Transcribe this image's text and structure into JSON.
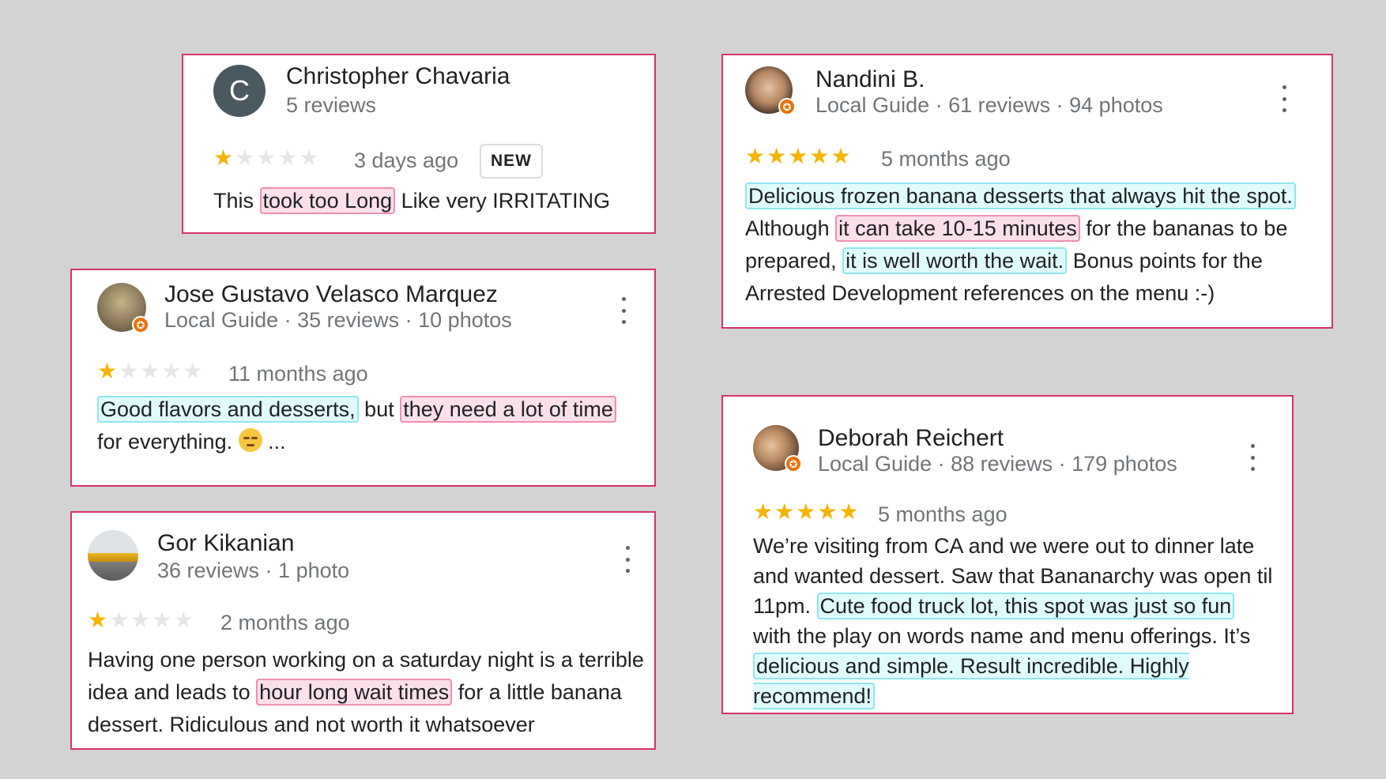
{
  "colors": {
    "background": "#d3d3d3",
    "card_border": "#d6336c",
    "star_filled": "#f5b400",
    "star_empty": "#e6e6e6",
    "positive_highlight": "#e0fbfc",
    "negative_highlight": "#fbe0ea",
    "local_guide_badge": "#e8710a"
  },
  "reviews": [
    {
      "name": "Christopher Chavaria",
      "avatar_letter": "C",
      "meta": "5 reviews",
      "rating": 1,
      "max_rating": 5,
      "time": "3 days ago",
      "badge": "NEW",
      "text": {
        "pre": "This ",
        "neg1": "took too Long",
        "post": " Like very IRRITATING"
      }
    },
    {
      "name": "Jose Gustavo Velasco Marquez",
      "meta": "Local Guide · 35 reviews · 10 photos",
      "rating": 1,
      "max_rating": 5,
      "time": "11 months ago",
      "text": {
        "pos1": "Good flavors and desserts,",
        "mid": " but ",
        "neg1": "they need a lot of time",
        "post": " for everything. ",
        "ellipsis": " ..."
      }
    },
    {
      "name": "Gor Kikanian",
      "meta": "36 reviews · 1 photo",
      "rating": 1,
      "max_rating": 5,
      "time": "2 months ago",
      "text": {
        "pre": "Having one person working on a saturday night is a terrible idea and leads to ",
        "neg1": "hour long wait times",
        "post": " for a little banana dessert. Ridiculous and not worth it whatsoever"
      }
    },
    {
      "name": "Nandini B.",
      "meta": "Local Guide · 61 reviews · 94 photos",
      "rating": 5,
      "max_rating": 5,
      "time": "5 months ago",
      "text": {
        "pos1": "Delicious frozen banana desserts that always hit the spot.",
        "mid1": " Although ",
        "neg1": "it can take 10-15 minutes",
        "mid2": " for the bananas to be prepared, ",
        "pos2": "it is well worth the wait.",
        "post": " Bonus points for the Arrested Development references on the menu :-)"
      }
    },
    {
      "name": "Deborah Reichert",
      "meta": "Local Guide · 88 reviews · 179 photos",
      "rating": 5,
      "max_rating": 5,
      "time": "5 months ago",
      "text": {
        "pre": "We’re visiting from CA and we were out to dinner late and wanted dessert. Saw that Bananarchy was open til 11pm. ",
        "pos1": "Cute food truck lot, this spot was just so fun",
        "mid": " with the play on words name and menu offerings. It’s ",
        "pos2": "delicious and simple. Result incredible. Highly recommend!"
      }
    }
  ]
}
